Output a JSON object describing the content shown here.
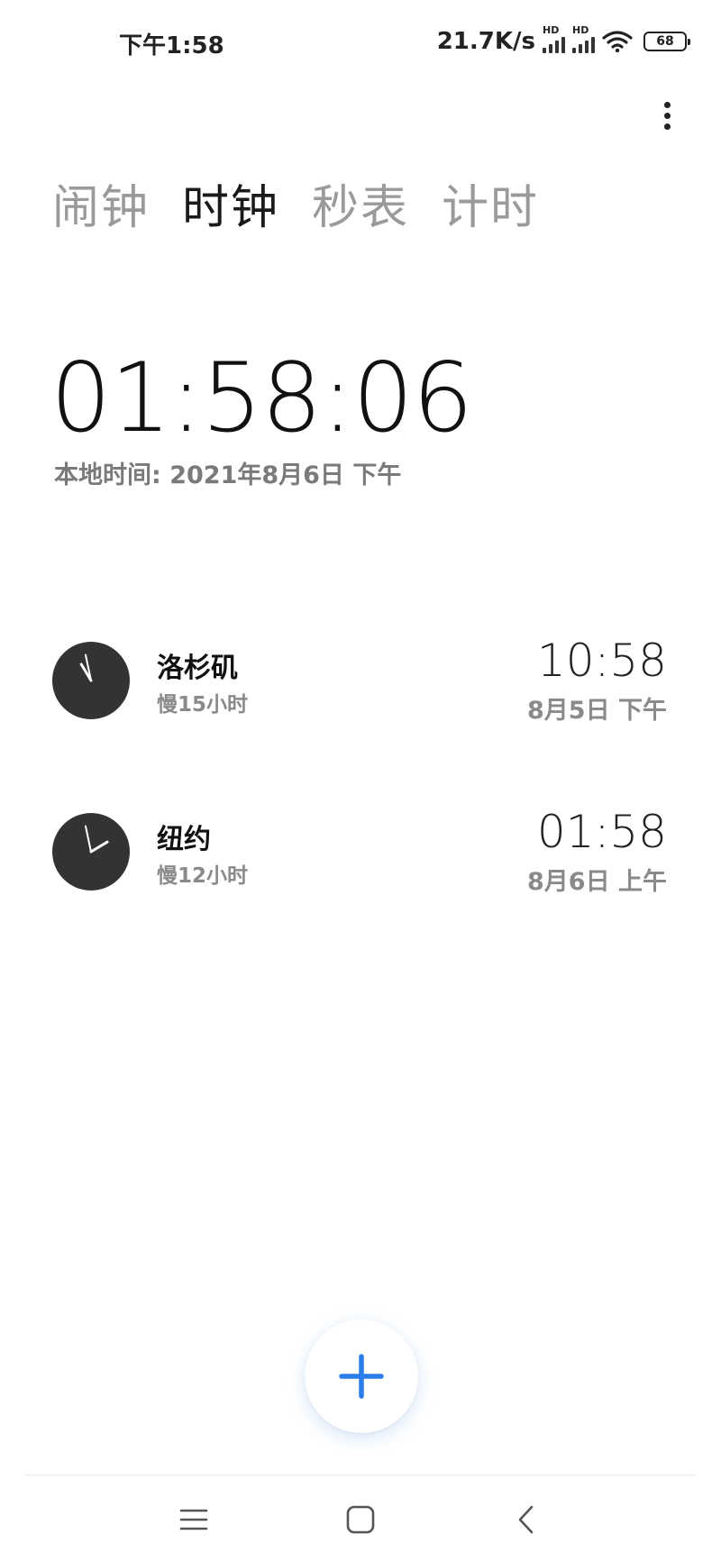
{
  "status_bar": {
    "time": "下午1:58",
    "net_speed": "21.7K/s",
    "signal1_label": "HD",
    "signal2_label": "HD",
    "battery": "68",
    "icons": [
      "signal-icon",
      "signal-icon",
      "wifi-icon",
      "battery-icon"
    ]
  },
  "header": {
    "more_icon": "more-vertical-icon"
  },
  "tabs": [
    {
      "label": "闹钟",
      "active": false
    },
    {
      "label": "时钟",
      "active": true
    },
    {
      "label": "秒表",
      "active": false
    },
    {
      "label": "计时",
      "active": false
    }
  ],
  "main": {
    "time": "01:58:06",
    "local_date": "本地时间: 2021年8月6日 下午"
  },
  "cities": [
    {
      "name": "洛杉矶",
      "diff": "慢15小时",
      "time": "10:58",
      "date": "8月5日 下午",
      "hour": 10,
      "minute": 58
    },
    {
      "name": "纽约",
      "diff": "慢12小时",
      "time": "01:58",
      "date": "8月6日 上午",
      "hour": 1,
      "minute": 58
    }
  ],
  "add_button": {
    "icon": "plus-icon",
    "color": "#2b7de9"
  },
  "nav": {
    "menu_icon": "menu-icon",
    "home_icon": "home-icon",
    "back_icon": "back-icon"
  },
  "colors": {
    "accent": "#2b7de9",
    "clock_face": "#333333",
    "muted_text": "#8a8a8a"
  }
}
